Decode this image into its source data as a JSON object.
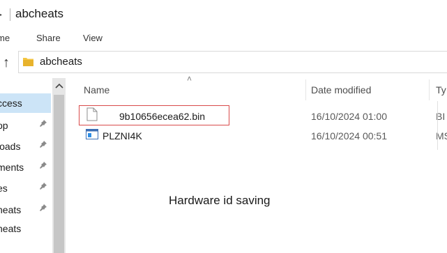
{
  "window": {
    "title": "abcheats",
    "title_arrow": "▸"
  },
  "ribbon": {
    "tabs": [
      "me",
      "Share",
      "View"
    ]
  },
  "address": {
    "up": "↑",
    "path": "abcheats"
  },
  "nav": {
    "scroll_up": "⌃",
    "items": [
      {
        "label": "ccess",
        "selected": true,
        "pinned": false
      },
      {
        "label": "op",
        "selected": false,
        "pinned": true
      },
      {
        "label": "loads",
        "selected": false,
        "pinned": true
      },
      {
        "label": "ments",
        "selected": false,
        "pinned": true
      },
      {
        "label": "es",
        "selected": false,
        "pinned": true
      },
      {
        "label": "heats",
        "selected": false,
        "pinned": true
      },
      {
        "label": "heats",
        "selected": false,
        "pinned": false
      }
    ],
    "pin_glyph": "⚙"
  },
  "columns": {
    "name": "Name",
    "date": "Date modified",
    "type": "Ty",
    "sort_glyph": "˄"
  },
  "files": [
    {
      "name": "9b10656ecea62.bin",
      "date": "16/10/2024 01:00",
      "type": "BI",
      "icon": "file-icon",
      "highlighted": true
    },
    {
      "name": "PLZNI4K",
      "date": "16/10/2024 00:51",
      "type": "MS",
      "icon": "app-window-icon",
      "highlighted": false
    }
  ],
  "caption": "Hardware id saving"
}
